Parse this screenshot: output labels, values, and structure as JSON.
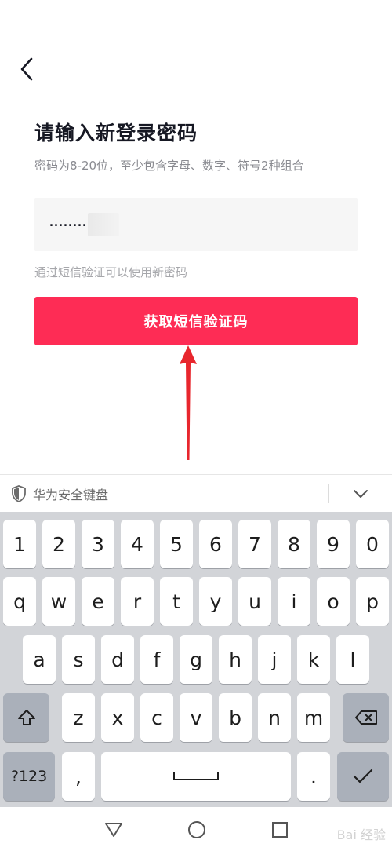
{
  "page": {
    "title": "请输入新登录密码",
    "subtitle": "密码为8-20位，至少包含字母、数字、符号2种组合",
    "password_value": "........",
    "hint": "通过短信验证可以使用新密码",
    "sms_button_label": "获取短信验证码"
  },
  "colors": {
    "accent": "#fe2c55",
    "arrow": "#e8262d"
  },
  "icons": {
    "back": "chevron-left-icon",
    "shield": "shield-icon",
    "collapse": "chevron-down-icon",
    "shift": "shift-icon",
    "backspace": "backspace-icon",
    "enter": "check-icon"
  },
  "keyboard": {
    "brand": "华为安全键盘",
    "row_numbers": [
      "1",
      "2",
      "3",
      "4",
      "5",
      "6",
      "7",
      "8",
      "9",
      "0"
    ],
    "row_top": [
      "q",
      "w",
      "e",
      "r",
      "t",
      "y",
      "u",
      "i",
      "o",
      "p"
    ],
    "row_middle": [
      "a",
      "s",
      "d",
      "f",
      "g",
      "h",
      "j",
      "k",
      "l"
    ],
    "row_bottom": [
      "z",
      "x",
      "c",
      "v",
      "b",
      "n",
      "m"
    ],
    "symbols_label": "?123",
    "comma": ",",
    "period": "."
  },
  "watermark": "Bai 经验"
}
